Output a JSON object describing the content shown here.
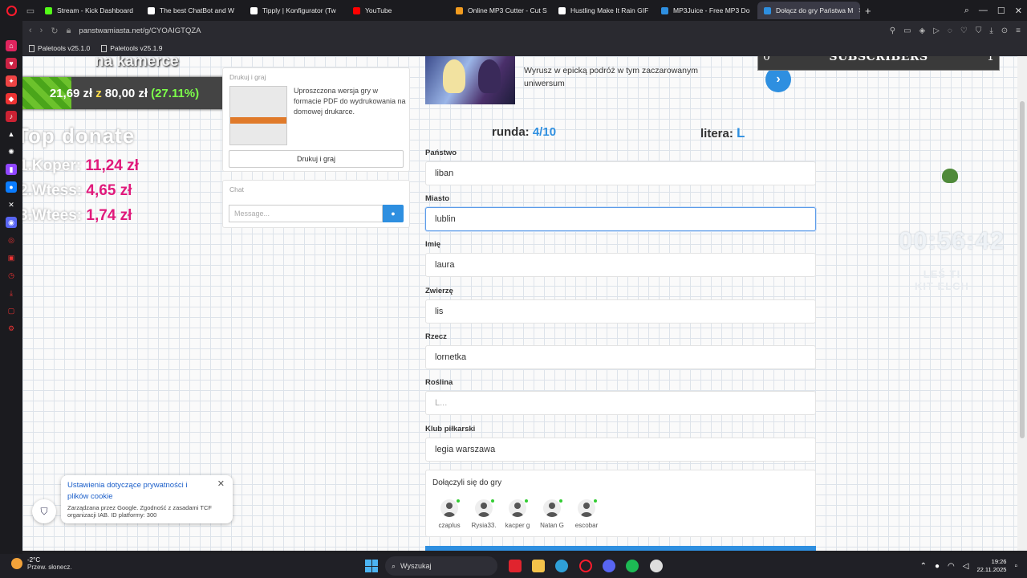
{
  "browser": {
    "tabs": [
      {
        "label": "Stream - Kick Dashboard",
        "color": "#53fc18"
      },
      {
        "label": "The best ChatBot and W",
        "color": "#ffffff"
      },
      {
        "label": "Tipply | Konfigurator (Tw",
        "color": "#ffffff"
      },
      {
        "label": "YouTube",
        "color": "#ff0000"
      },
      {
        "label": "Online MP3 Cutter - Cut S",
        "color": "#f29c1f"
      },
      {
        "label": "Hustling Make It Rain GIF",
        "color": "#ffffff"
      },
      {
        "label": "MP3Juice - Free MP3 Do",
        "color": "#2e8fe0"
      },
      {
        "label": "Dołącz do gry Państwa M",
        "color": "#2e8fe0"
      }
    ],
    "url": "panstwamiasta.net/g/CYOAIGTQZA",
    "bookmarks": [
      "Paletools v25.1.0",
      "Paletools v25.1.9"
    ]
  },
  "overlay": {
    "kamerce": "na kamerce",
    "goal_current": "21,69 zł",
    "goal_sep": "z",
    "goal_target": "80,00 zł",
    "goal_percent": "(27.11%)",
    "goal_fraction": 0.2711,
    "top_donate_title": "Top donate",
    "donors": [
      {
        "name": "1.Koper:",
        "amount": "11,24 zł"
      },
      {
        "name": "2.Wtess:",
        "amount": "4,65 zł"
      },
      {
        "name": "3.Wtees:",
        "amount": "1,74 zł"
      }
    ],
    "subs_left": "0",
    "subs_label": "SUBSCRIBERS",
    "subs_right": "1",
    "timer": "00:56:42",
    "timer_sub_1": "LEŚ TI",
    "timer_sub_2": "KIT ELCH"
  },
  "print_card": {
    "title": "Drukuj i graj",
    "description": "Uproszczona wersja gry w formacie PDF do wydrukowania na domowej drukarce.",
    "button": "Drukuj i graj"
  },
  "chat": {
    "title": "Chat",
    "placeholder": "Message...",
    "send_icon": "chat-bubble-icon"
  },
  "banner": {
    "text": "Wyrusz w epicką podróż w tym zaczarowanym uniwersum"
  },
  "game": {
    "round_label": "runda:",
    "round_value": "4/10",
    "letter_label": "litera:",
    "letter_value": "L",
    "fields": [
      {
        "label": "Państwo",
        "value": "liban"
      },
      {
        "label": "Miasto",
        "value": "lublin"
      },
      {
        "label": "Imię",
        "value": "laura"
      },
      {
        "label": "Zwierzę",
        "value": "lis"
      },
      {
        "label": "Rzecz",
        "value": "lornetka"
      },
      {
        "label": "Roślina",
        "value": "",
        "placeholder": "L..."
      },
      {
        "label": "Klub piłkarski",
        "value": "legia warszawa"
      }
    ],
    "players_title": "Dołączyli się do gry",
    "players": [
      "czaplus",
      "Rysia33.",
      "kacper g",
      "Natan G",
      "escobar"
    ]
  },
  "cookie": {
    "title": "Ustawienia dotyczące prywatności i plików cookie",
    "subtitle": "Zarządzana przez Google. Zgodność z zasadami TCF organizacji IAB. ID platformy: 300"
  },
  "taskbar": {
    "temp": "-2°C",
    "weather": "Przew. słonecz.",
    "search": "Wyszukaj",
    "time": "19:26",
    "date": "22.11.2025"
  }
}
